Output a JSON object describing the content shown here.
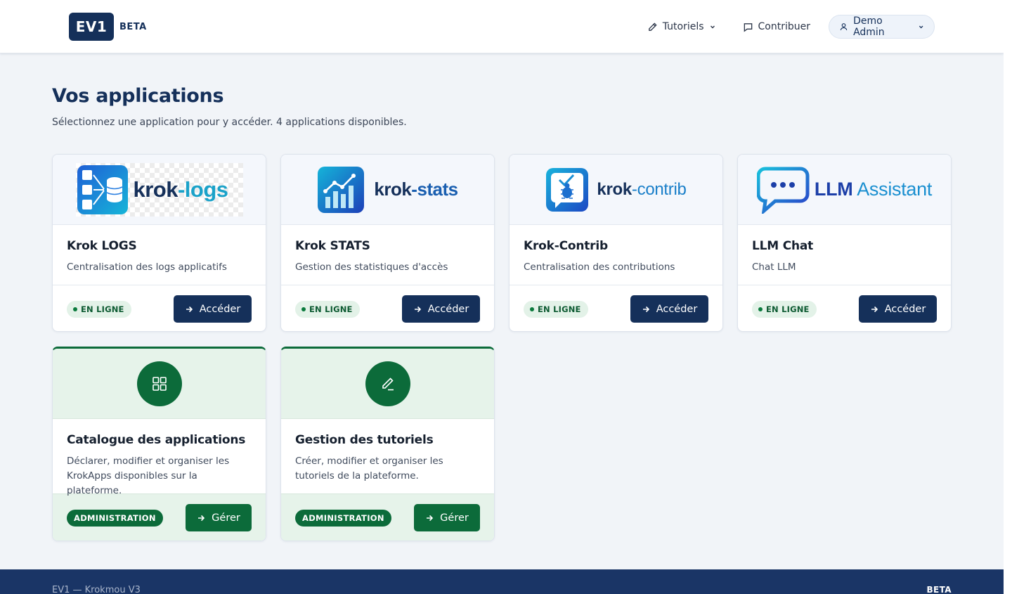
{
  "header": {
    "logo_text": "EV1",
    "logo_badge": "BETA",
    "nav": {
      "tutoriels": "Tutoriels",
      "contribuer": "Contribuer",
      "user": "Demo Admin"
    }
  },
  "main": {
    "title": "Vos applications",
    "subtitle": "Sélectionnez une application pour y accéder. 4 applications disponibles."
  },
  "apps": [
    {
      "logo_text_a": "krok",
      "logo_text_b": "-logs",
      "title": "Krok LOGS",
      "desc": "Centralisation des logs applicatifs",
      "status": "EN LIGNE",
      "button": "Accéder"
    },
    {
      "logo_text_a": "krok",
      "logo_text_b": "-stats",
      "title": "Krok STATS",
      "desc": "Gestion des statistiques d'accès",
      "status": "EN LIGNE",
      "button": "Accéder"
    },
    {
      "logo_text_a": "krok",
      "logo_text_b": "-contrib",
      "title": "Krok-Contrib",
      "desc": "Centralisation des contributions",
      "status": "EN LIGNE",
      "button": "Accéder"
    },
    {
      "logo_text_a": "LLM",
      "logo_text_b": " Assistant",
      "title": "LLM Chat",
      "desc": "Chat LLM",
      "status": "EN LIGNE",
      "button": "Accéder"
    }
  ],
  "admin": [
    {
      "icon": "grid-icon",
      "title": "Catalogue des applications",
      "desc": "Déclarer, modifier et organiser les KrokApps disponibles sur la plateforme.",
      "badge": "ADMINISTRATION",
      "button": "Gérer"
    },
    {
      "icon": "pen-icon",
      "title": "Gestion des tutoriels",
      "desc": "Créer, modifier et organiser les tutoriels de la plateforme.",
      "badge": "ADMINISTRATION",
      "button": "Gérer"
    }
  ],
  "footer": {
    "left": "EV1 — Krokmou V3",
    "right": "BETA"
  },
  "colors": {
    "primary": "#15305a",
    "admin_green": "#0c6b3a",
    "background": "#f1f4f8"
  }
}
